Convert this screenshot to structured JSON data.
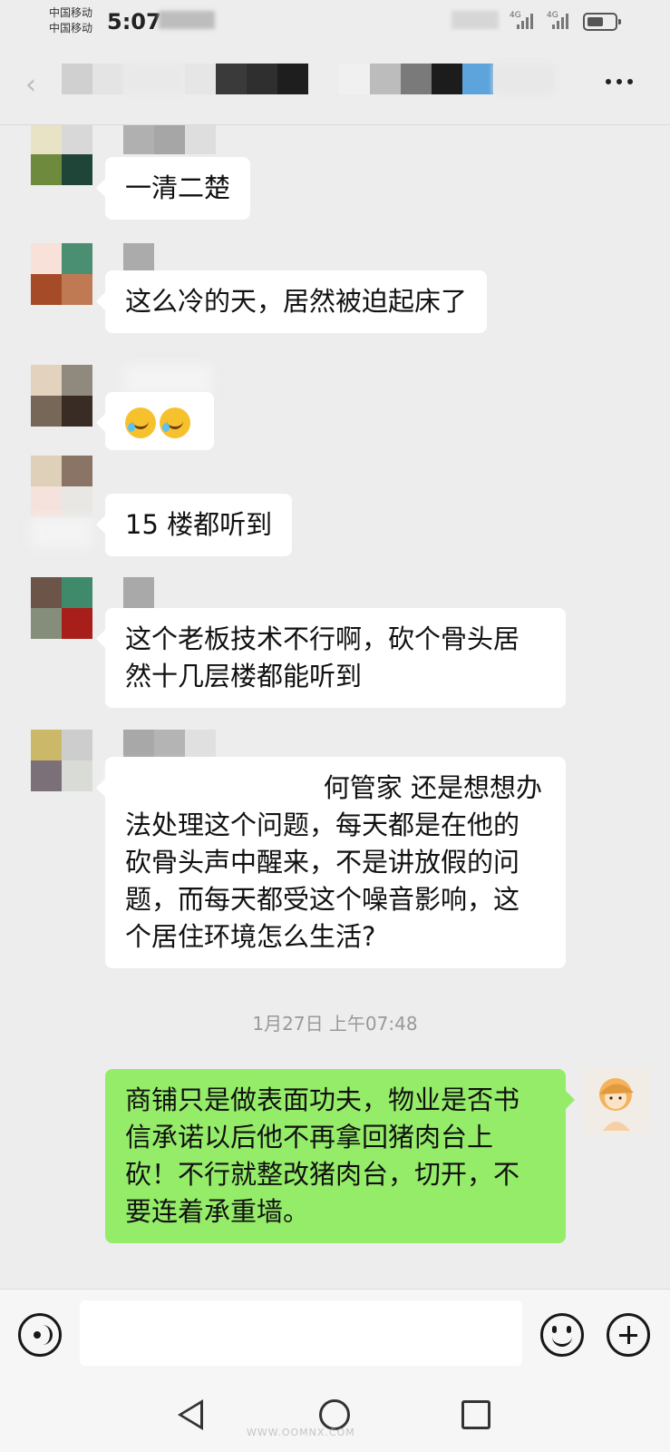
{
  "status_bar": {
    "carrier_1": "中国移动",
    "carrier_2": "中国移动",
    "time": "5:07",
    "net_1": "4G",
    "net_2": "4G"
  },
  "header": {
    "more_label": "more-icon"
  },
  "messages": [
    {
      "side": "left",
      "text": "一清二楚"
    },
    {
      "side": "left",
      "text": "这么冷的天，居然被迫起床了"
    },
    {
      "side": "left",
      "type": "emoji",
      "emoji": "face-with-tears-of-joy x2"
    },
    {
      "side": "left",
      "text": "15 楼都听到"
    },
    {
      "side": "left",
      "lines": [
        "这个老板技术不行啊，砍个骨头居",
        "然十几层楼都能听到"
      ]
    },
    {
      "side": "left",
      "lines": [
        "何管家  还是想想办",
        "法处理这个问题，每天都是在他的",
        "砍骨头声中醒来，不是讲放假的问",
        "题，而每天都受这个噪音影响，这",
        "个居住环境怎么生活?"
      ]
    },
    {
      "side": "right",
      "lines": [
        "商铺只是做表面功夫，物业是否书",
        "信承诺以后他不再拿回猪肉台上",
        "砍！不行就整改猪肉台，切开，不",
        "要连着承重墙。"
      ]
    }
  ],
  "timestamp": "1月27日 上午07:48",
  "input_bar": {
    "voice_icon": "voice-icon",
    "emoji_icon": "smile-icon",
    "plus_icon": "plus-icon"
  },
  "watermark": "WWW.OOMNX.COM",
  "colors": {
    "background": "#ededed",
    "bubble_left": "#ffffff",
    "bubble_right": "#95ec69"
  }
}
